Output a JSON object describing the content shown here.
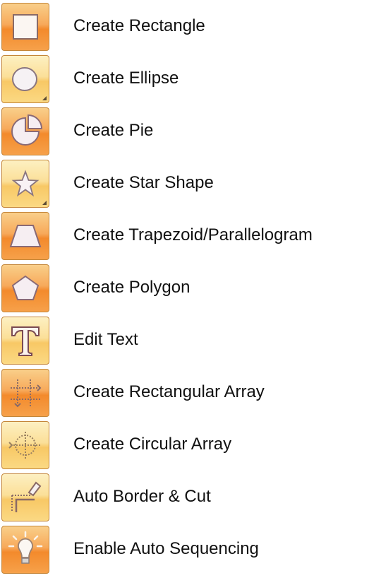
{
  "tools": [
    {
      "label": "Create Rectangle",
      "icon": "rectangle-icon"
    },
    {
      "label": "Create Ellipse",
      "icon": "ellipse-icon"
    },
    {
      "label": "Create Pie",
      "icon": "pie-icon"
    },
    {
      "label": "Create Star Shape",
      "icon": "star-icon"
    },
    {
      "label": "Create Trapezoid/Parallelogram",
      "icon": "trapezoid-icon"
    },
    {
      "label": "Create Polygon",
      "icon": "polygon-icon"
    },
    {
      "label": "Edit Text",
      "icon": "text-icon"
    },
    {
      "label": "Create Rectangular Array",
      "icon": "rectangular-array-icon"
    },
    {
      "label": "Create Circular Array",
      "icon": "circular-array-icon"
    },
    {
      "label": "Auto Border & Cut",
      "icon": "border-cut-icon"
    },
    {
      "label": "Enable Auto Sequencing",
      "icon": "lightbulb-icon"
    }
  ]
}
